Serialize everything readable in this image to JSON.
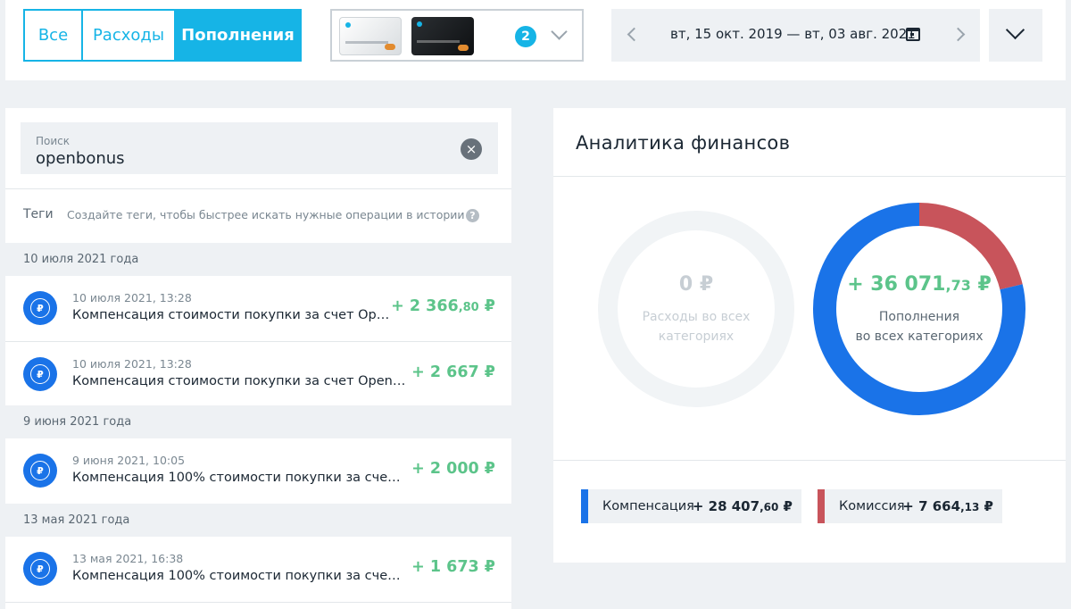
{
  "filters": {
    "tabs": [
      {
        "label": "Все"
      },
      {
        "label": "Расходы"
      },
      {
        "label": "Пополнения"
      }
    ],
    "active": "Пополнения"
  },
  "cards": {
    "count": "2"
  },
  "date_range": {
    "text": "вт, 15 окт. 2019 — вт, 03 авг. 2021"
  },
  "search": {
    "label": "Поиск",
    "value": "openbonus",
    "clear_icon": "×"
  },
  "tags": {
    "label": "Теги",
    "hint": "Создайте теги, чтобы быстрее искать нужные операции в истории",
    "help_icon": "?"
  },
  "history": {
    "groups": [
      {
        "date": "10 июля 2021 года",
        "items": [
          {
            "time": "10 июля 2021, 13:28",
            "desc": "Компенсация стоимости покупки за счет Op…",
            "amount_int": "+ 2 366",
            "amount_frac": ",80",
            "currency": " ₽"
          },
          {
            "time": "10 июля 2021, 13:28",
            "desc": "Компенсация стоимости покупки за счет Open…",
            "amount_int": "+ 2 667",
            "amount_frac": "",
            "currency": " ₽"
          }
        ]
      },
      {
        "date": "9 июня 2021 года",
        "items": [
          {
            "time": "9 июня 2021, 10:05",
            "desc": "Компенсация 100% стоимости покупки за счет…",
            "amount_int": "+ 2 000",
            "amount_frac": "",
            "currency": " ₽"
          }
        ]
      },
      {
        "date": "13 мая 2021 года",
        "items": [
          {
            "time": "13 мая 2021, 16:38",
            "desc": "Компенсация 100% стоимости покупки за счет …",
            "amount_int": "+ 1 673",
            "amount_frac": "",
            "currency": " ₽"
          }
        ]
      }
    ],
    "item_icon_glyph": "₽"
  },
  "analytics": {
    "title": "Аналитика финансов",
    "expenses": {
      "amount": "0 ₽",
      "label_line1": "Расходы во всех",
      "label_line2": "категориях"
    },
    "income": {
      "amount_int": "+ 36 071",
      "amount_frac": ",73",
      "currency": " ₽",
      "label_line1": "Пополнения",
      "label_line2": "во всех категориях"
    },
    "breakdown": [
      {
        "name": "Компенсация",
        "value": 28407.6,
        "value_int": "+ 28 407",
        "value_frac": ",60",
        "currency": " ₽",
        "color": "#1a73e8"
      },
      {
        "name": "Комиссия",
        "value": 7664.13,
        "value_int": "+ 7 664",
        "value_frac": ",13",
        "currency": " ₽",
        "color": "#c8545b"
      }
    ]
  },
  "colors": {
    "accent": "#16b4e6",
    "income_green": "#5cc48a",
    "icon_blue": "#1a73e8"
  }
}
